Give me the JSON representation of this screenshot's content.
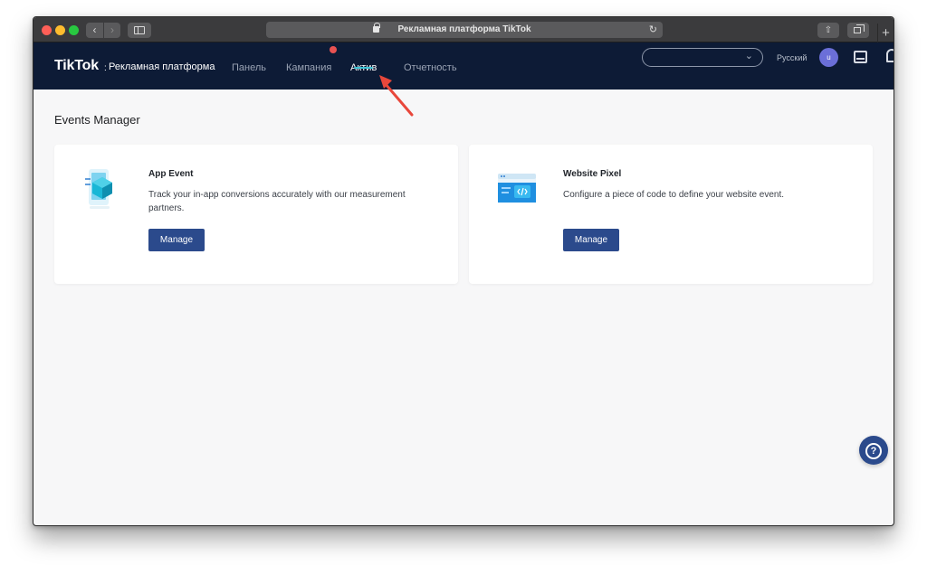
{
  "browser": {
    "url_title": "Рекламная платформа TikTok"
  },
  "header": {
    "logo": "TikTok",
    "logo_separator": ":",
    "subtitle": "Рекламная платформа",
    "menu": [
      {
        "label": "Панель"
      },
      {
        "label": "Кампания"
      },
      {
        "label": "Актив"
      },
      {
        "label": "Отчетность"
      }
    ],
    "active_menu": "Актив",
    "language": "Русский",
    "avatar_initial": "u"
  },
  "main": {
    "page_title": "Events Manager",
    "cards": [
      {
        "title": "App Event",
        "description": "Track your in-app conversions accurately with our measurement partners.",
        "button": "Manage",
        "icon": "app-event-illustration"
      },
      {
        "title": "Website Pixel",
        "description": "Configure a piece of code to define your website event.",
        "button": "Manage",
        "icon": "website-pixel-illustration"
      }
    ]
  },
  "colors": {
    "header_bg": "#0d1b36",
    "accent": "#3ec3d5",
    "button": "#2b4a8c",
    "annotation": "#e8473b"
  }
}
